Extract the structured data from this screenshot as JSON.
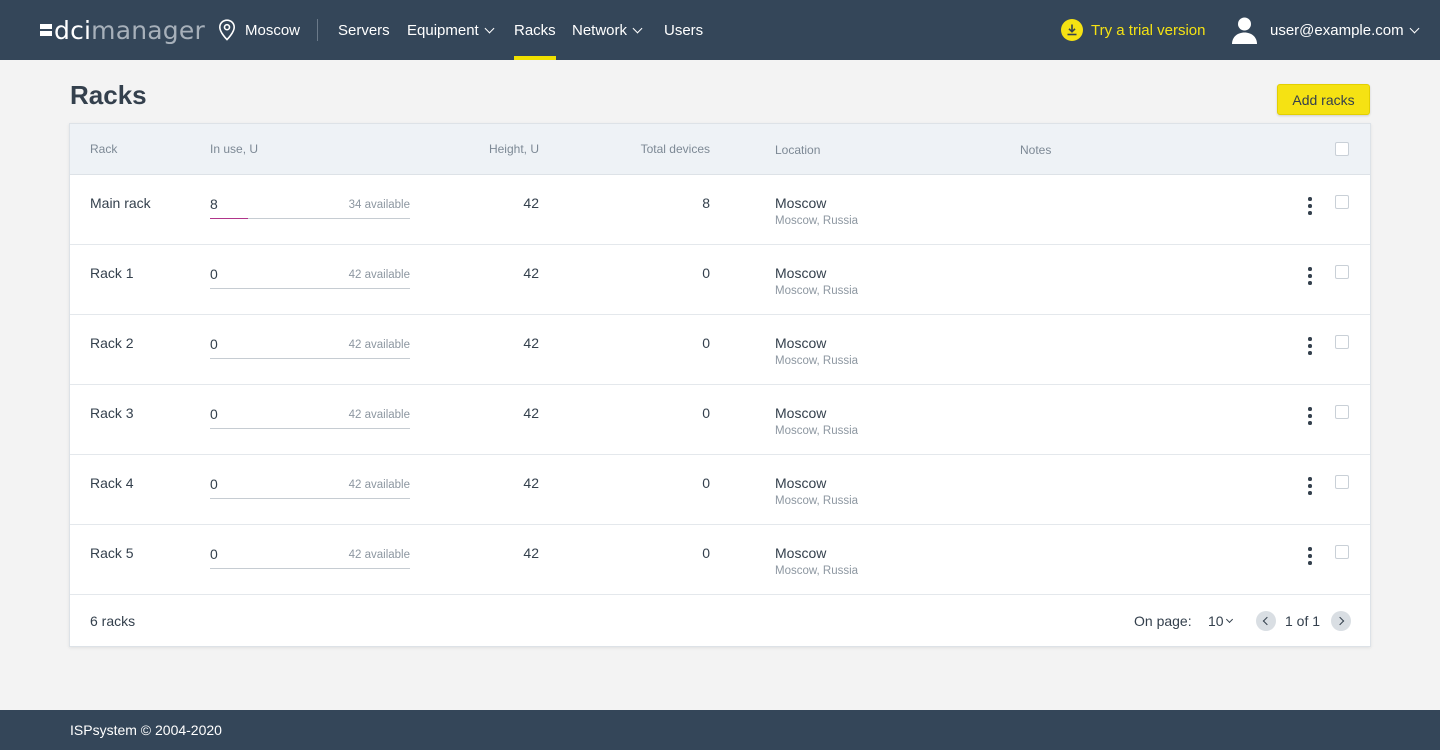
{
  "header": {
    "logo_dci": "dci",
    "logo_manager": "manager",
    "location": "Moscow",
    "nav": [
      {
        "label": "Servers",
        "dropdown": false,
        "active": false
      },
      {
        "label": "Equipment",
        "dropdown": true,
        "active": false
      },
      {
        "label": "Racks",
        "dropdown": false,
        "active": true
      },
      {
        "label": "Network",
        "dropdown": true,
        "active": false
      },
      {
        "label": "Users",
        "dropdown": false,
        "active": false
      }
    ],
    "trial_label": "Try a trial version",
    "user_email": "user@example.com"
  },
  "page": {
    "title": "Racks",
    "add_button": "Add racks"
  },
  "table": {
    "columns": {
      "rack": "Rack",
      "in_use": "In use, U",
      "height": "Height, U",
      "total_devices": "Total devices",
      "location": "Location",
      "notes": "Notes"
    },
    "rows": [
      {
        "name": "Main rack",
        "in_use": "8",
        "available": "34 available",
        "usage_fraction": 0.19,
        "height": "42",
        "total_devices": "8",
        "location": "Moscow",
        "location_sub": "Moscow, Russia"
      },
      {
        "name": "Rack 1",
        "in_use": "0",
        "available": "42 available",
        "usage_fraction": 0,
        "height": "42",
        "total_devices": "0",
        "location": "Moscow",
        "location_sub": "Moscow, Russia"
      },
      {
        "name": "Rack 2",
        "in_use": "0",
        "available": "42 available",
        "usage_fraction": 0,
        "height": "42",
        "total_devices": "0",
        "location": "Moscow",
        "location_sub": "Moscow, Russia"
      },
      {
        "name": "Rack 3",
        "in_use": "0",
        "available": "42 available",
        "usage_fraction": 0,
        "height": "42",
        "total_devices": "0",
        "location": "Moscow",
        "location_sub": "Moscow, Russia"
      },
      {
        "name": "Rack 4",
        "in_use": "0",
        "available": "42 available",
        "usage_fraction": 0,
        "height": "42",
        "total_devices": "0",
        "location": "Moscow",
        "location_sub": "Moscow, Russia"
      },
      {
        "name": "Rack 5",
        "in_use": "0",
        "available": "42 available",
        "usage_fraction": 0,
        "height": "42",
        "total_devices": "0",
        "location": "Moscow",
        "location_sub": "Moscow, Russia"
      }
    ],
    "footer": {
      "count": "6 racks",
      "on_page_label": "On page:",
      "on_page_value": "10",
      "pagination": "1 of 1"
    }
  },
  "footer": {
    "copyright": "ISPsystem © 2004-2020"
  },
  "colors": {
    "header_bg": "#344659",
    "accent_yellow": "#f5e213",
    "usage_bar": "#b0358a"
  }
}
